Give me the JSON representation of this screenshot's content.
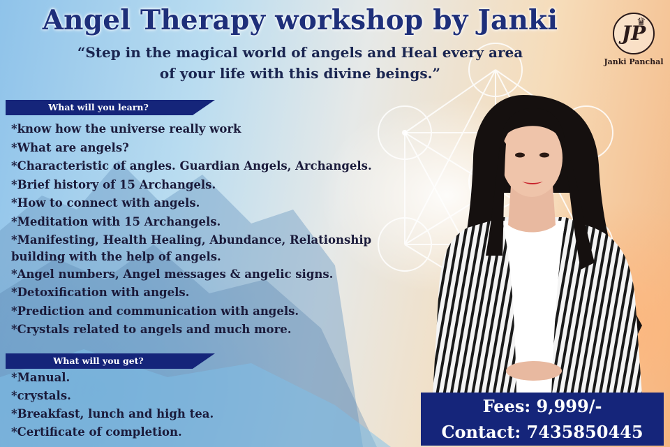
{
  "title": "Angel Therapy workshop by Janki",
  "subtitle_line1": "“Step in the magical world of angels and Heal every area",
  "subtitle_line2": "of your life with this divine beings.”",
  "logo": {
    "letters": "JP",
    "name": "Janki Panchal",
    "icon": "crown-icon"
  },
  "learn": {
    "heading": "What will you learn?",
    "items": [
      "*know how the universe really work",
      "*What are angels?",
      "*Characteristic of angles. Guardian Angels, Archangels.",
      "*Brief history of 15 Archangels.",
      "*How to connect with angels.",
      "*Meditation with 15 Archangels.",
      "*Manifesting, Health Healing, Abundance, Relationship",
      "building with the help of angels.",
      "*Angel numbers, Angel messages & angelic signs.",
      "*Detoxification with angels.",
      "*Prediction and communication with angels.",
      "*Crystals related to angels and much more."
    ]
  },
  "get": {
    "heading": "What will you get?",
    "items": [
      "*Manual.",
      "*crystals.",
      "*Breakfast, lunch and high tea.",
      "*Certificate of completion."
    ]
  },
  "fees": "Fees: 9,999/-",
  "contact": "Contact: 7435850445",
  "colors": {
    "navy": "#15257a",
    "title": "#1e2f7a",
    "text": "#1a1a3a"
  }
}
